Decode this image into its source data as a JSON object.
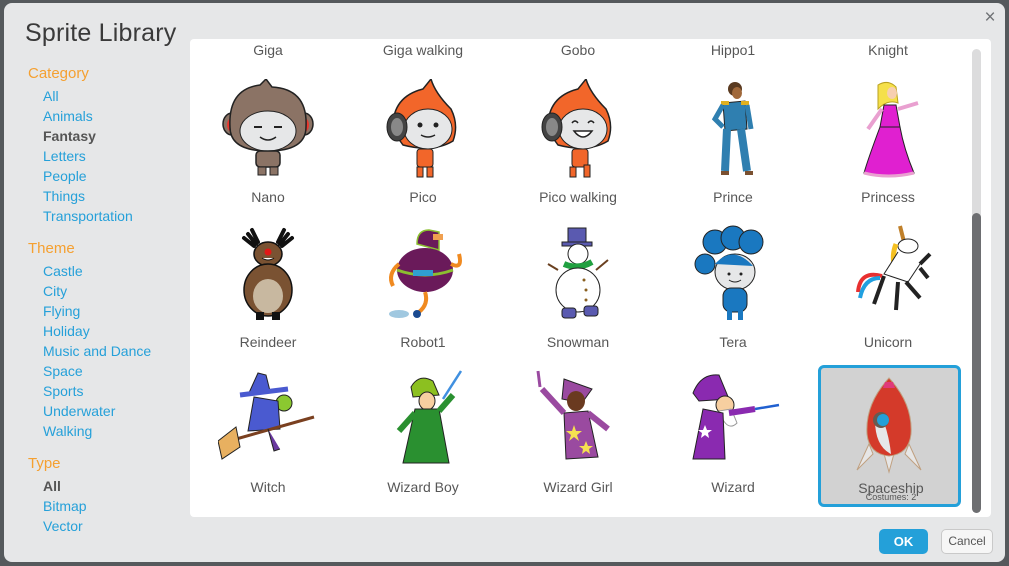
{
  "dialog": {
    "title": "Sprite Library",
    "close_label": "×"
  },
  "sidebar": {
    "category": {
      "heading": "Category",
      "items": [
        {
          "label": "All",
          "selected": false
        },
        {
          "label": "Animals",
          "selected": false
        },
        {
          "label": "Fantasy",
          "selected": true
        },
        {
          "label": "Letters",
          "selected": false
        },
        {
          "label": "People",
          "selected": false
        },
        {
          "label": "Things",
          "selected": false
        },
        {
          "label": "Transportation",
          "selected": false
        }
      ]
    },
    "theme": {
      "heading": "Theme",
      "items": [
        {
          "label": "Castle"
        },
        {
          "label": "City"
        },
        {
          "label": "Flying"
        },
        {
          "label": "Holiday"
        },
        {
          "label": "Music and Dance"
        },
        {
          "label": "Space"
        },
        {
          "label": "Sports"
        },
        {
          "label": "Underwater"
        },
        {
          "label": "Walking"
        }
      ]
    },
    "type": {
      "heading": "Type",
      "items": [
        {
          "label": "All",
          "selected": true
        },
        {
          "label": "Bitmap",
          "selected": false
        },
        {
          "label": "Vector",
          "selected": false
        }
      ]
    }
  },
  "library": {
    "partial_row": [
      "Giga",
      "Giga walking",
      "Gobo",
      "Hippo1",
      "Knight"
    ],
    "sprites": [
      {
        "name": "Nano",
        "icon": "nano-sprite-icon"
      },
      {
        "name": "Pico",
        "icon": "pico-sprite-icon"
      },
      {
        "name": "Pico walking",
        "icon": "pico-walking-sprite-icon"
      },
      {
        "name": "Prince",
        "icon": "prince-sprite-icon"
      },
      {
        "name": "Princess",
        "icon": "princess-sprite-icon"
      },
      {
        "name": "Reindeer",
        "icon": "reindeer-sprite-icon"
      },
      {
        "name": "Robot1",
        "icon": "robot1-sprite-icon"
      },
      {
        "name": "Snowman",
        "icon": "snowman-sprite-icon"
      },
      {
        "name": "Tera",
        "icon": "tera-sprite-icon"
      },
      {
        "name": "Unicorn",
        "icon": "unicorn-sprite-icon"
      },
      {
        "name": "Witch",
        "icon": "witch-sprite-icon"
      },
      {
        "name": "Wizard Boy",
        "icon": "wizard-boy-sprite-icon"
      },
      {
        "name": "Wizard Girl",
        "icon": "wizard-girl-sprite-icon"
      },
      {
        "name": "Wizard",
        "icon": "wizard-sprite-icon"
      },
      {
        "name": "Spaceship",
        "icon": "spaceship-sprite-icon",
        "selected": true,
        "costumes_label": "Costumes: 2"
      }
    ],
    "scroll_position_fraction": 0.35
  },
  "buttons": {
    "ok_label": "OK",
    "cancel_label": "Cancel"
  },
  "colors": {
    "accent": "#24a0d9",
    "heading": "#f5a030",
    "link": "#25a0d9"
  }
}
